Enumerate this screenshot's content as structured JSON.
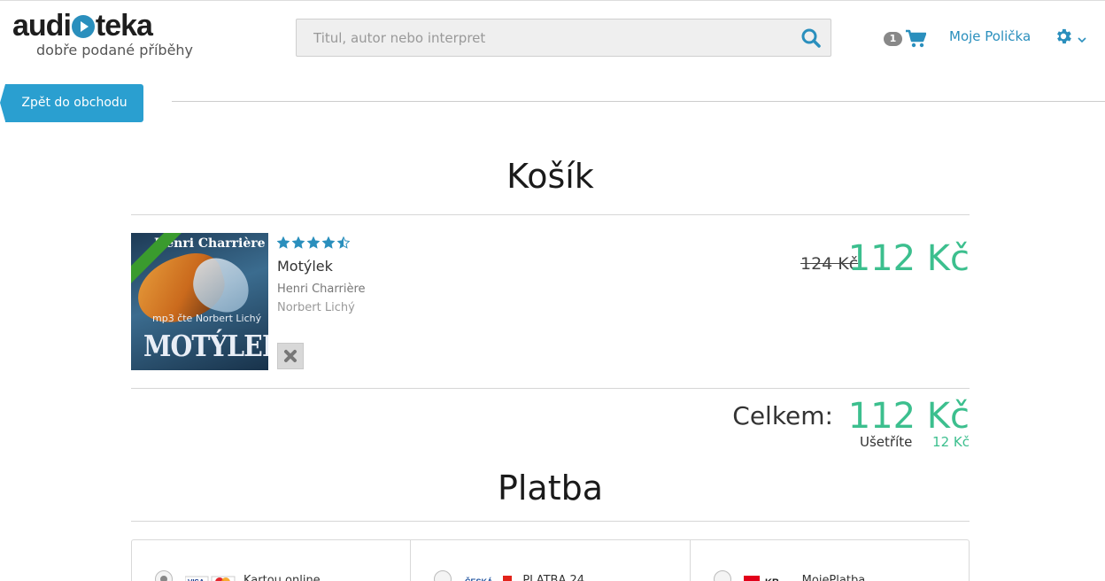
{
  "header": {
    "logo_left": "audi",
    "logo_right": "teka",
    "tagline": "dobře podané příběhy",
    "search_placeholder": "Titul, autor nebo interpret",
    "cart_count": "1",
    "shelf_link": "Moje Polička"
  },
  "nav": {
    "back_button": "Zpět do obchodu"
  },
  "cart": {
    "title": "Košík",
    "item": {
      "cover_author": "Henri Charrière",
      "cover_narrator": "mp3 čte Norbert Lichý",
      "cover_title": "MOTÝLEK",
      "rating": 4.5,
      "title": "Motýlek",
      "author": "Henri Charrière",
      "narrator": "Norbert Lichý",
      "old_price": "124 Kč",
      "price": "112 Kč"
    },
    "total_label": "Celkem:",
    "total_price": "112 Kč",
    "savings_label": "Ušetříte",
    "savings_value": "12 Kč"
  },
  "payment": {
    "title": "Platba",
    "options": [
      {
        "label": "Kartou online",
        "logo": "card-logos",
        "selected": true
      },
      {
        "label": "PLATBA 24",
        "logo": "ceska-sporitelna-logo",
        "selected": false
      },
      {
        "label": "MojePlatba",
        "logo": "kb-logo",
        "selected": false
      }
    ]
  },
  "colors": {
    "accent": "#2a8fbd",
    "price": "#3cbf8e",
    "button": "#2a9fd0"
  }
}
